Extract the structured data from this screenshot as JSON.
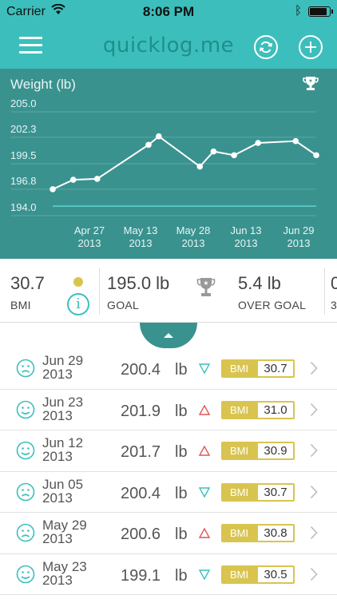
{
  "status_bar": {
    "carrier": "Carrier",
    "time": "8:06 PM"
  },
  "nav": {
    "logo": "quicklog.me",
    "icons": [
      "menu-icon",
      "refresh-icon",
      "plus-icon"
    ]
  },
  "chart_data": {
    "type": "line",
    "title": "Weight (lb)",
    "y_ticks": [
      "205.0",
      "202.3",
      "199.5",
      "196.8",
      "194.0"
    ],
    "ylim": [
      194.0,
      205.0
    ],
    "x_ticks": [
      {
        "month": "Apr 27",
        "year": "2013"
      },
      {
        "month": "May 13",
        "year": "2013"
      },
      {
        "month": "May 28",
        "year": "2013"
      },
      {
        "month": "Jun 13",
        "year": "2013"
      },
      {
        "month": "Jun 29",
        "year": "2013"
      }
    ],
    "x": [
      "2013-04-13",
      "2013-04-19",
      "2013-04-26",
      "2013-05-11",
      "2013-05-14",
      "2013-05-26",
      "2013-05-30",
      "2013-06-05",
      "2013-06-12",
      "2013-06-23",
      "2013-06-29"
    ],
    "values": [
      196.8,
      197.8,
      197.9,
      201.5,
      202.4,
      199.2,
      200.8,
      200.4,
      201.7,
      201.9,
      200.4
    ],
    "goal_line": 195.0,
    "grid": true,
    "colors": {
      "background": "#3a928f",
      "line": "#ffffff",
      "goal": "#5fd3cf"
    }
  },
  "stats": {
    "bmi": {
      "value": "30.7",
      "label": "BMI"
    },
    "goal": {
      "value": "195.0 lb",
      "label": "GOAL"
    },
    "over": {
      "value": "5.4 lb",
      "label": "OVER GOAL"
    },
    "partial_next": {
      "value": "0",
      "label": "3"
    }
  },
  "entries": [
    {
      "date_line1": "Jun 29",
      "date_line2": "2013",
      "weight": "200.4",
      "unit": "lb",
      "trend": "down",
      "bmi_label": "BMI",
      "bmi": "30.7",
      "mood": "sad"
    },
    {
      "date_line1": "Jun 23",
      "date_line2": "2013",
      "weight": "201.9",
      "unit": "lb",
      "trend": "up",
      "bmi_label": "BMI",
      "bmi": "31.0",
      "mood": "happy"
    },
    {
      "date_line1": "Jun 12",
      "date_line2": "2013",
      "weight": "201.7",
      "unit": "lb",
      "trend": "up",
      "bmi_label": "BMI",
      "bmi": "30.9",
      "mood": "happy"
    },
    {
      "date_line1": "Jun 05",
      "date_line2": "2013",
      "weight": "200.4",
      "unit": "lb",
      "trend": "down",
      "bmi_label": "BMI",
      "bmi": "30.7",
      "mood": "sad"
    },
    {
      "date_line1": "May 29",
      "date_line2": "2013",
      "weight": "200.6",
      "unit": "lb",
      "trend": "up",
      "bmi_label": "BMI",
      "bmi": "30.8",
      "mood": "sad"
    },
    {
      "date_line1": "May 23",
      "date_line2": "2013",
      "weight": "199.1",
      "unit": "lb",
      "trend": "down",
      "bmi_label": "BMI",
      "bmi": "30.5",
      "mood": "happy"
    }
  ],
  "colors": {
    "teal": "#3cbfbc",
    "dark_teal": "#3a928f",
    "bmi_gold": "#d9c450",
    "trend_up": "#e05656",
    "trend_down": "#3cbfbc"
  }
}
